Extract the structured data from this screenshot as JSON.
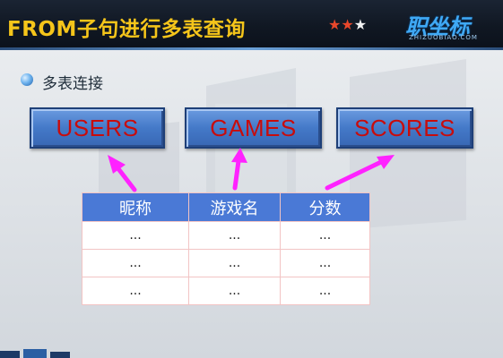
{
  "header": {
    "title": "FROM子句进行多表查询",
    "stars": {
      "red": "★★",
      "white": "★"
    },
    "logo": {
      "main": "职坐标",
      "sub": "ZHIZUOBIAO.COM"
    }
  },
  "bullet": {
    "text": "多表连接"
  },
  "tables": [
    "USERS",
    "GAMES",
    "SCORES"
  ],
  "grid": {
    "headers": [
      "昵称",
      "游戏名",
      "分数"
    ],
    "rows": [
      [
        "...",
        "...",
        "..."
      ],
      [
        "...",
        "...",
        "..."
      ],
      [
        "...",
        "...",
        "..."
      ]
    ]
  },
  "colors": {
    "title": "#f5c51a",
    "box": "#4479c8",
    "boxText": "#c80c0c",
    "arrow": "#ff22ff",
    "tableHeader": "#4a79d6"
  }
}
